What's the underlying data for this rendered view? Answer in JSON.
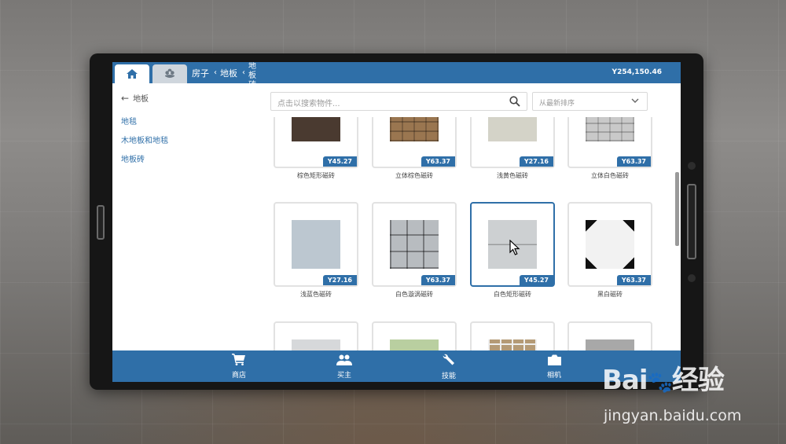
{
  "header": {
    "breadcrumbs": [
      "房子",
      "地板",
      "地板砖"
    ],
    "balance": "Y254,150.46"
  },
  "sidebar": {
    "back_label": "地板",
    "categories": [
      "地毯",
      "木地板和地毯",
      "地板砖"
    ]
  },
  "search": {
    "placeholder": "点击以搜索物件..."
  },
  "sort": {
    "selected": "从最新排序"
  },
  "products": [
    {
      "name": "棕色矩形磁砖",
      "price": "Y45.27",
      "color": "#4a3a30"
    },
    {
      "name": "立体棕色磁砖",
      "price": "Y63.37",
      "color": "#9a7650"
    },
    {
      "name": "浅黄色磁砖",
      "price": "Y27.16",
      "color": "#d4d3c8"
    },
    {
      "name": "立体白色磁砖",
      "price": "Y63.37",
      "color": "#c9c9c9"
    },
    {
      "name": "浅蓝色磁砖",
      "price": "Y27.16",
      "color": "#bcc7d0"
    },
    {
      "name": "白色漩涡磁砖",
      "price": "Y63.37",
      "color": "#b8bcc0"
    },
    {
      "name": "白色矩形磁砖",
      "price": "Y45.27",
      "color": "#cdd0d2"
    },
    {
      "name": "黑白磁砖",
      "price": "Y63.37",
      "color": "#f2f2f2"
    },
    {
      "name": "",
      "price": "",
      "color": "#d6d8da"
    },
    {
      "name": "",
      "price": "",
      "color": "#b9cfa0"
    },
    {
      "name": "",
      "price": "",
      "color": "#b49a76"
    },
    {
      "name": "",
      "price": "",
      "color": "#a8a8a8"
    }
  ],
  "bottom_nav": [
    {
      "label": "商店",
      "icon": "cart-icon"
    },
    {
      "label": "买主",
      "icon": "people-icon"
    },
    {
      "label": "技能",
      "icon": "wrench-icon"
    },
    {
      "label": "相机",
      "icon": "camera-icon"
    }
  ],
  "watermark": {
    "logo": "Bai",
    "logo_suffix": "经验",
    "url": "jingyan.baidu.com"
  }
}
